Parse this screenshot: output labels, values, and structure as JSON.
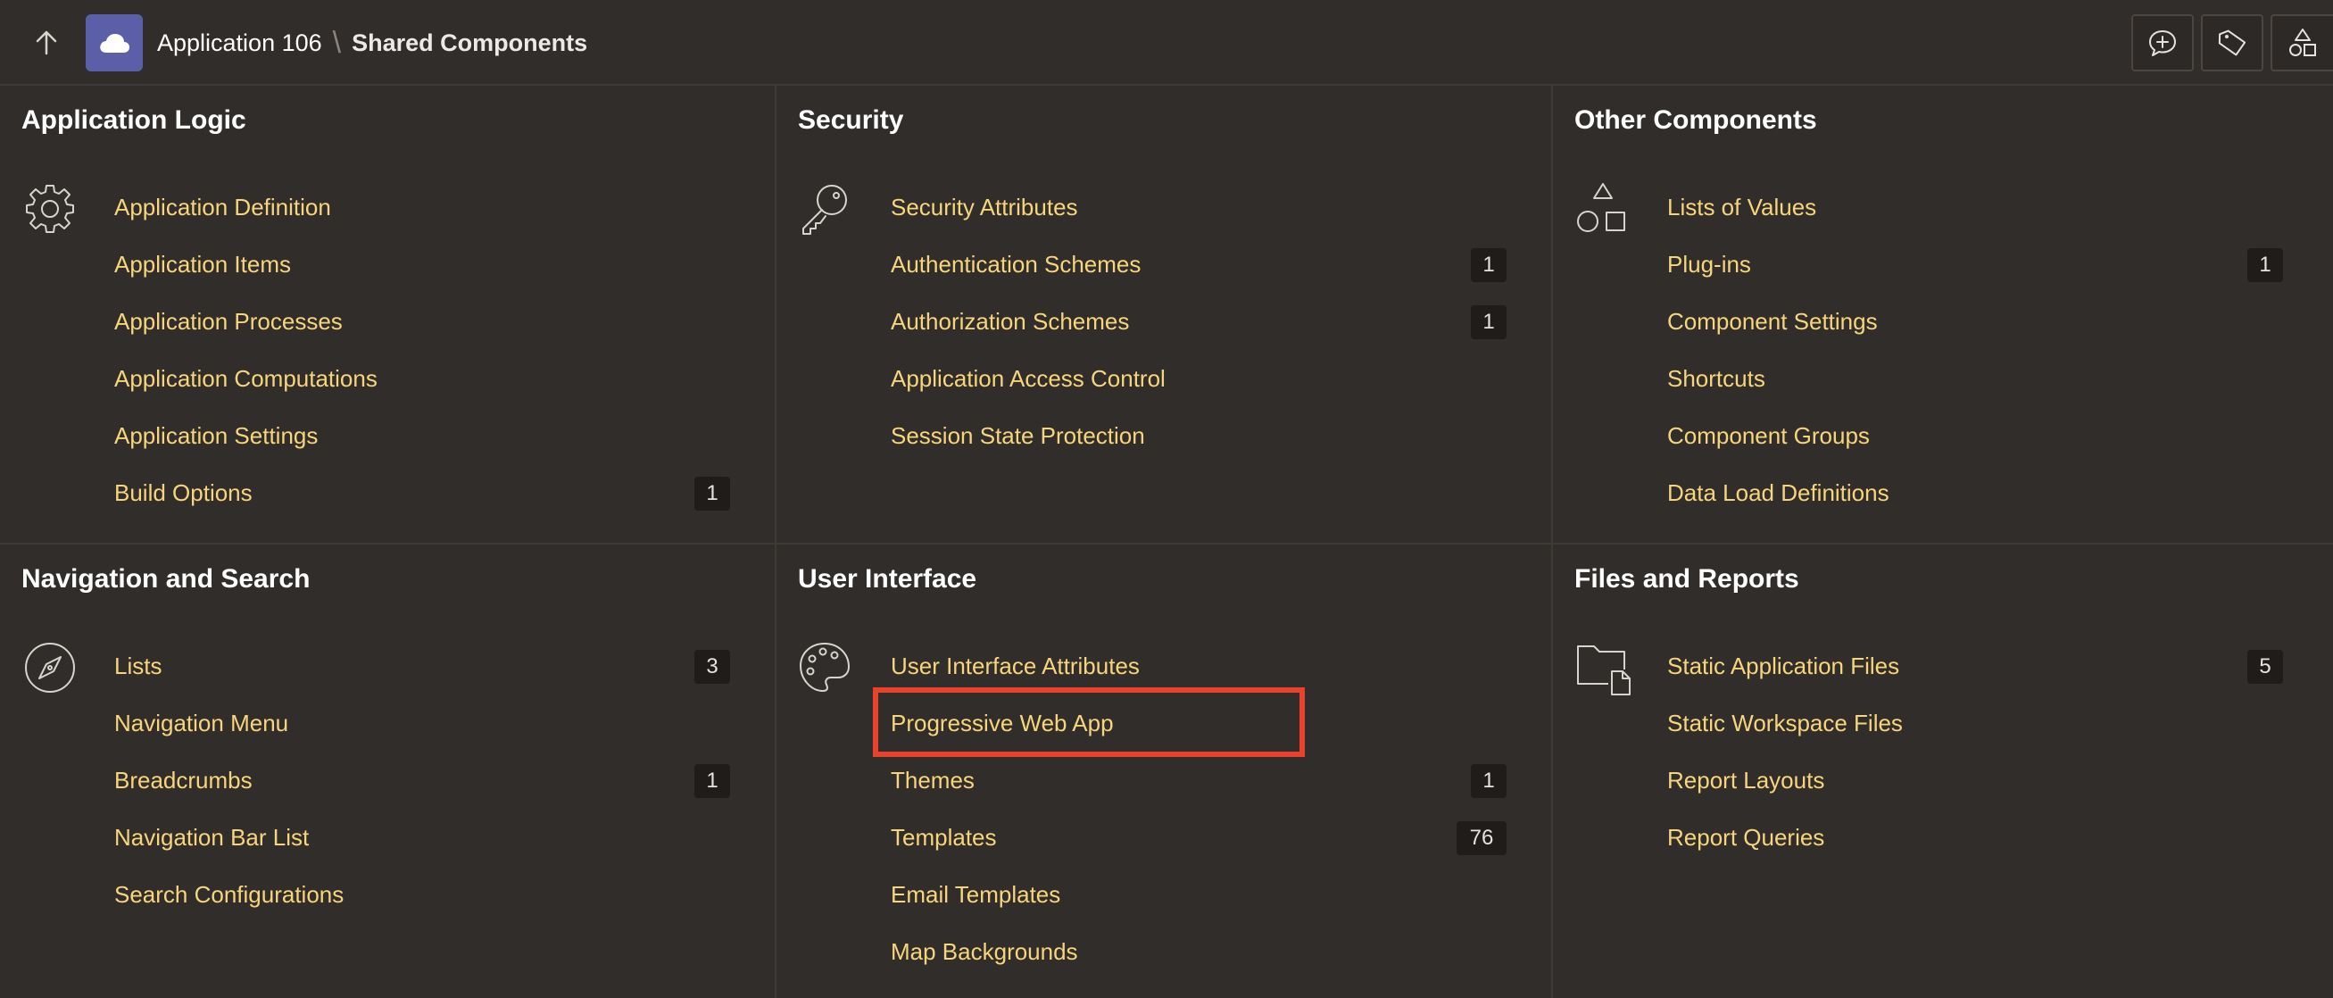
{
  "header": {
    "app_link": "Application 106",
    "separator": "\\",
    "current_page": "Shared Components"
  },
  "icons": {
    "up": "up-arrow-icon",
    "app": "cloud-icon",
    "tool1": "add-comment-icon",
    "tool2": "tag-icon",
    "tool3": "shapes-icon"
  },
  "colors": {
    "background": "#312d2a",
    "link": "#f7d57d",
    "highlight": "#e8412c",
    "app_icon": "#5b5fa8"
  },
  "panels": [
    {
      "title": "Application Logic",
      "icon": "gear-icon",
      "items": [
        {
          "label": "Application Definition",
          "count": ""
        },
        {
          "label": "Application Items",
          "count": ""
        },
        {
          "label": "Application Processes",
          "count": ""
        },
        {
          "label": "Application Computations",
          "count": ""
        },
        {
          "label": "Application Settings",
          "count": ""
        },
        {
          "label": "Build Options",
          "count": "1"
        }
      ]
    },
    {
      "title": "Security",
      "icon": "key-icon",
      "items": [
        {
          "label": "Security Attributes",
          "count": ""
        },
        {
          "label": "Authentication Schemes",
          "count": "1"
        },
        {
          "label": "Authorization Schemes",
          "count": "1"
        },
        {
          "label": "Application Access Control",
          "count": ""
        },
        {
          "label": "Session State Protection",
          "count": ""
        }
      ]
    },
    {
      "title": "Other Components",
      "icon": "shapes-icon",
      "items": [
        {
          "label": "Lists of Values",
          "count": ""
        },
        {
          "label": "Plug-ins",
          "count": "1"
        },
        {
          "label": "Component Settings",
          "count": ""
        },
        {
          "label": "Shortcuts",
          "count": ""
        },
        {
          "label": "Component Groups",
          "count": ""
        },
        {
          "label": "Data Load Definitions",
          "count": ""
        }
      ]
    },
    {
      "title": "Navigation and Search",
      "icon": "compass-icon",
      "items": [
        {
          "label": "Lists",
          "count": "3"
        },
        {
          "label": "Navigation Menu",
          "count": ""
        },
        {
          "label": "Breadcrumbs",
          "count": "1"
        },
        {
          "label": "Navigation Bar List",
          "count": ""
        },
        {
          "label": "Search Configurations",
          "count": ""
        }
      ]
    },
    {
      "title": "User Interface",
      "icon": "palette-icon",
      "items": [
        {
          "label": "User Interface Attributes",
          "count": ""
        },
        {
          "label": "Progressive Web App",
          "count": ""
        },
        {
          "label": "Themes",
          "count": "1"
        },
        {
          "label": "Templates",
          "count": "76"
        },
        {
          "label": "Email Templates",
          "count": ""
        },
        {
          "label": "Map Backgrounds",
          "count": ""
        }
      ]
    },
    {
      "title": "Files and Reports",
      "icon": "folder-file-icon",
      "items": [
        {
          "label": "Static Application Files",
          "count": "5"
        },
        {
          "label": "Static Workspace Files",
          "count": ""
        },
        {
          "label": "Report Layouts",
          "count": ""
        },
        {
          "label": "Report Queries",
          "count": ""
        }
      ]
    }
  ]
}
